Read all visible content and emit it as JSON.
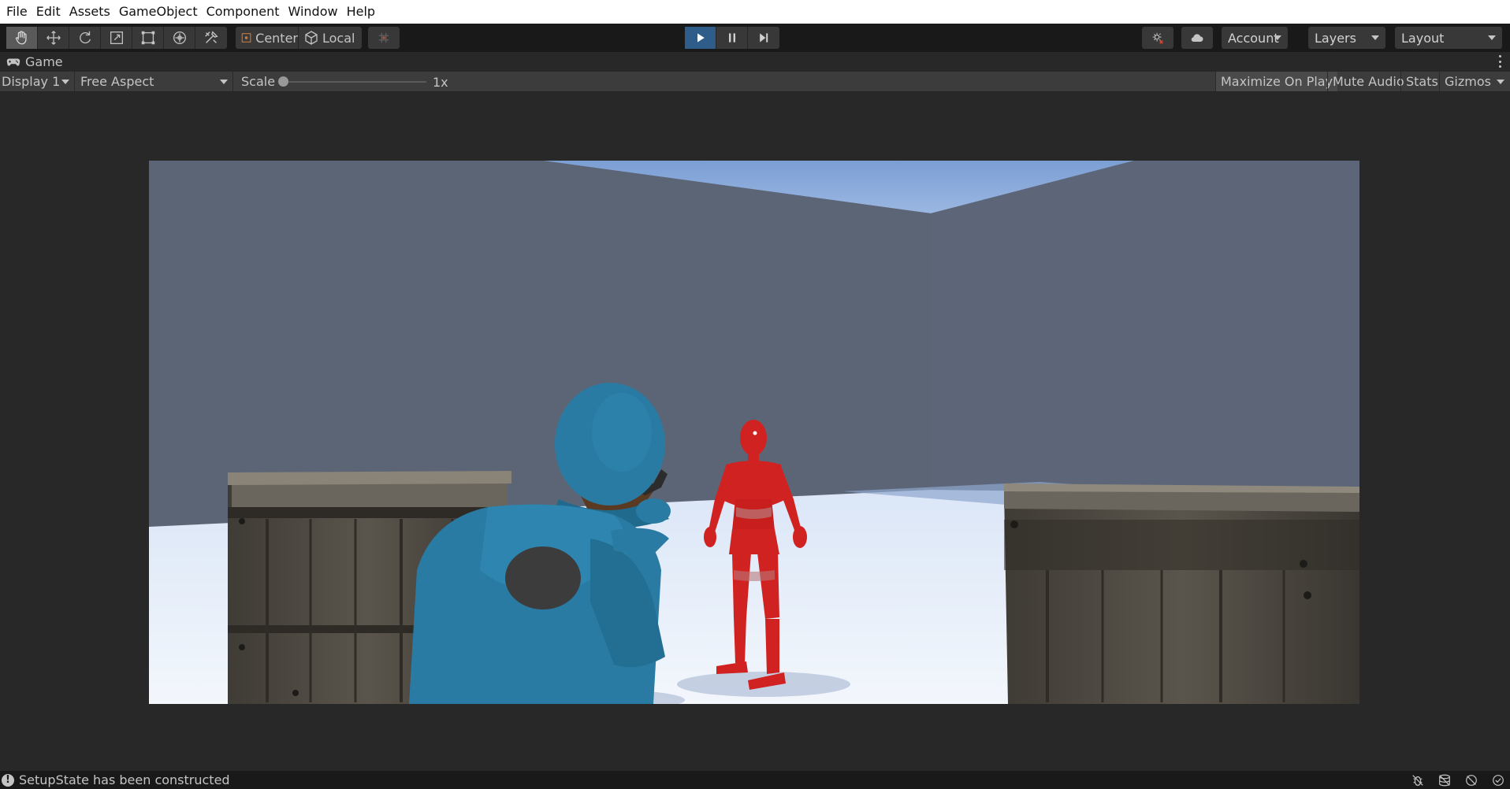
{
  "menu": {
    "items": [
      "File",
      "Edit",
      "Assets",
      "GameObject",
      "Component",
      "Window",
      "Help"
    ]
  },
  "toolbar": {
    "tools": [
      "hand-tool-icon",
      "move-tool-icon",
      "rotate-tool-icon",
      "scale-tool-icon",
      "rect-tool-icon",
      "transform-tool-icon",
      "custom-tool-icon"
    ],
    "pivot_mode": "Center",
    "pivot_rotation": "Local",
    "account_label": "Account",
    "layers_label": "Layers",
    "layout_label": "Layout",
    "play_active": true
  },
  "tab": {
    "title": "Game"
  },
  "game_bar": {
    "display": "Display 1",
    "aspect": "Free Aspect",
    "scale_label": "Scale",
    "scale_value": "1x",
    "scale_fraction": 0.0,
    "maximize_on_play": "Maximize On Play",
    "mute_audio": "Mute Audio",
    "stats": "Stats",
    "gizmos": "Gizmos"
  },
  "status": {
    "message": "SetupState has been constructed"
  },
  "colors": {
    "play_active": "#2f5d8a",
    "wall": "#5d6677",
    "sky": "#7fa2d6",
    "floor": "#e9f1fb",
    "enemy": "#d12222",
    "player": "#2a7ba3"
  }
}
